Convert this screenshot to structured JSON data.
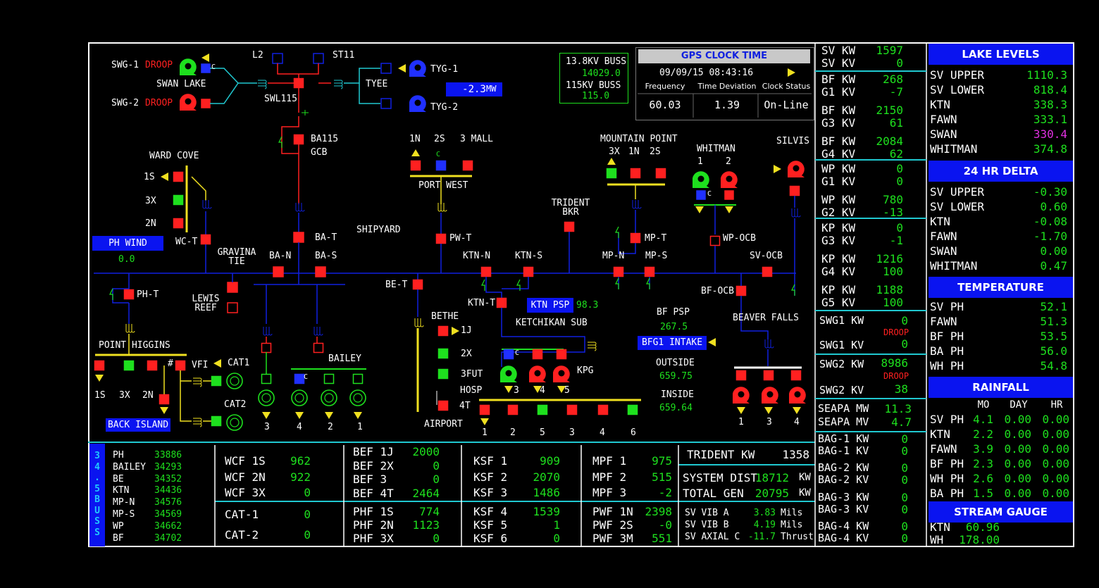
{
  "colors": {
    "background": "#000000",
    "bus_line": "#1020e0",
    "energized": "#ff2020",
    "deenergized": "#1ee01e",
    "value": "#1ee01e",
    "header_blue": "#0a14f0",
    "cyan_line": "#20c8d0",
    "yellow": "#f0e020"
  },
  "one_line": {
    "labels": {
      "swg1": "SWG-1",
      "swg2": "SWG-2",
      "droop1": "DROOP",
      "droop2": "DROOP",
      "swan_lake": "SWAN LAKE",
      "l2": "L2",
      "st11": "ST11",
      "swl115": "SWL115",
      "tyee": "TYEE",
      "tyg1": "TYG-1",
      "tyg2": "TYG-2",
      "tyee_mw_value": "-2.3",
      "tyee_mw_unit": "MW",
      "ba115": "BA115",
      "gcb": "GCB",
      "ward_cove": "WARD COVE",
      "wc_1s": "1S",
      "wc_3x": "3X",
      "wc_2n": "2N",
      "ph_wind": "PH WIND",
      "ph_wind_value": "0.0",
      "wc_t": "WC-T",
      "gravina_tie": "GRAVINA\nTIE",
      "ba_t": "BA-T",
      "ba_n": "BA-N",
      "ba_s": "BA-S",
      "shipyard": "SHIPYARD",
      "ph_t": "PH-T",
      "lewis_reef": "LEWIS\nREEF",
      "point_higgins": "POINT  HIGGINS",
      "ph_1s": "1S",
      "ph_3x": "3X",
      "ph_2n": "2N",
      "hash": "#",
      "vfi": "VFI",
      "cat1": "CAT1",
      "cat2": "CAT2",
      "back_island": "BACK ISLAND",
      "bailey": "BAILEY",
      "bailey_c": "C",
      "bailey_gen_3": "3",
      "bailey_gen_4": "4",
      "bailey_gen_2": "2",
      "bailey_gen_1": "1",
      "port_west": "PORT WEST",
      "pw_1n": "1N",
      "pw_2s": "2S",
      "pw_3mall": "3 MALL",
      "pw_c": "C",
      "pw_t": "PW-T",
      "be_t": "BE-T",
      "bethe": "BETHE",
      "be_1j": "1J",
      "be_2x": "2X",
      "be_3fut": "3FUT",
      "be_hosp": "HOSP",
      "be_4t": "4T",
      "airport": "AIRPORT",
      "ktn_n": "KTN-N",
      "ktn_s": "KTN-S",
      "ktn_t": "KTN-T",
      "ktn_psp": "KTN PSP",
      "ktn_psp_value": "98.3",
      "ketchikan_sub": "KETCHIKAN SUB",
      "kpg": "KPG",
      "kpg_c": "C",
      "kpg_3": "3",
      "kpg_4": "4",
      "kpg_5": "5",
      "ks_1": "1",
      "ks_2": "2",
      "ks_5": "5",
      "ks_3": "3",
      "ks_4": "4",
      "ks_6": "6",
      "trident_bkr": "TRIDENT\nBKR",
      "mountain_point": "MOUNTAIN POINT",
      "mp_3x": "3X",
      "mp_1n": "1N",
      "mp_2s": "2S",
      "mp_t": "MP-T",
      "mp_n": "MP-N",
      "mp_s": "MP-S",
      "whitman": "WHITMAN",
      "wh_1": "1",
      "wh_2": "2",
      "wh_c": "C",
      "wp_ocb": "WP-OCB",
      "silvis": "SILVIS",
      "sv_ocb": "SV-OCB",
      "bf_ocb": "BF-OCB",
      "beaver_falls": "BEAVER FALLS",
      "bf_1": "1",
      "bf_3": "3",
      "bf_4": "4",
      "bf_psp": "BF PSP",
      "bf_psp_value": "267.5",
      "bfg1_intake": "BFG1 INTAKE",
      "outside": "OUTSIDE",
      "outside_value": "659.75",
      "inside": "INSIDE",
      "inside_value": "659.64",
      "swg1_c": "C"
    }
  },
  "buss_box": {
    "line1": "13.8KV BUSS",
    "value1": "14029.0",
    "line2": "115KV BUSS",
    "value2": "115.0"
  },
  "gps": {
    "title": "GPS CLOCK TIME",
    "datetime": "09/09/15 08:43:16",
    "headers": [
      "Frequency",
      "Time Deviation",
      "Clock Status"
    ],
    "values": [
      "60.03",
      "1.39",
      "On-Line"
    ]
  },
  "buss_345": {
    "vertical_label": "34.5BUSS",
    "rows": [
      {
        "name": "PH",
        "value": "33886"
      },
      {
        "name": "BAILEY",
        "value": "34293"
      },
      {
        "name": "BE",
        "value": "34352"
      },
      {
        "name": "KTN",
        "value": "34436"
      },
      {
        "name": "MP-N",
        "value": "34576"
      },
      {
        "name": "MP-S",
        "value": "34569"
      },
      {
        "name": "WP",
        "value": "34662"
      },
      {
        "name": "BF",
        "value": "34702"
      }
    ]
  },
  "feeders": {
    "wcf": [
      {
        "name": "WCF 1S",
        "value": "962"
      },
      {
        "name": "WCF 2N",
        "value": "922"
      },
      {
        "name": "WCF 3X",
        "value": "0"
      }
    ],
    "cat": [
      {
        "name": "CAT-1",
        "value": "0"
      },
      {
        "name": "CAT-2",
        "value": "0"
      }
    ],
    "bef": [
      {
        "name": "BEF 1J",
        "value": "2000"
      },
      {
        "name": "BEF 2X",
        "value": "0"
      },
      {
        "name": "BEF 3",
        "value": "0"
      },
      {
        "name": "BEF 4T",
        "value": "2464"
      }
    ],
    "phf": [
      {
        "name": "PHF 1S",
        "value": "774"
      },
      {
        "name": "PHF 2N",
        "value": "1123"
      },
      {
        "name": "PHF 3X",
        "value": "0"
      }
    ],
    "ksf_a": [
      {
        "name": "KSF 1",
        "value": "909"
      },
      {
        "name": "KSF 2",
        "value": "2070"
      },
      {
        "name": "KSF 3",
        "value": "1486"
      }
    ],
    "ksf_b": [
      {
        "name": "KSF 4",
        "value": "1539"
      },
      {
        "name": "KSF 5",
        "value": "1"
      },
      {
        "name": "KSF 6",
        "value": "0"
      }
    ],
    "mpf": [
      {
        "name": "MPF 1",
        "value": "975"
      },
      {
        "name": "MPF 2",
        "value": "515"
      },
      {
        "name": "MPF 3",
        "value": "-2"
      }
    ],
    "pwf": [
      {
        "name": "PWF 1N",
        "value": "2398"
      },
      {
        "name": "PWF 2S",
        "value": "-0"
      },
      {
        "name": "PWF 3M",
        "value": "551"
      }
    ]
  },
  "totals": {
    "trident_label": "TRIDENT KW",
    "trident_value": "1358",
    "sysdist_label": "SYSTEM DIST",
    "sysdist_value": "18712",
    "sysdist_unit": "KW",
    "totalgen_label": "TOTAL GEN",
    "totalgen_value": "20795",
    "totalgen_unit": "KW",
    "vib": [
      {
        "name": "SV VIB A",
        "value": "3.83",
        "unit": "Mils"
      },
      {
        "name": "SV VIB B",
        "value": "4.19",
        "unit": "Mils"
      },
      {
        "name": "SV AXIAL C",
        "value": "-11.7",
        "unit": "Thrust"
      }
    ]
  },
  "gen_panel": {
    "sv": [
      {
        "name": "SV KW",
        "value": "1597"
      },
      {
        "name": "SV KV",
        "value": "0"
      }
    ],
    "bf": [
      {
        "name": "BF KW",
        "value": "268"
      },
      {
        "name": "G1 KV",
        "value": "-7"
      },
      {
        "name": "BF KW",
        "value": "2150"
      },
      {
        "name": "G3 KV",
        "value": "61"
      },
      {
        "name": "BF KW",
        "value": "2084"
      },
      {
        "name": "G4 KV",
        "value": "62"
      }
    ],
    "wp": [
      {
        "name": "WP KW",
        "value": "0"
      },
      {
        "name": "G1 KV",
        "value": "0"
      },
      {
        "name": "WP KW",
        "value": "780"
      },
      {
        "name": "G2 KV",
        "value": "-13"
      }
    ],
    "kp": [
      {
        "name": "KP KW",
        "value": "0"
      },
      {
        "name": "G3 KV",
        "value": "-1"
      },
      {
        "name": "KP KW",
        "value": "1216"
      },
      {
        "name": "G4 KV",
        "value": "100"
      },
      {
        "name": "KP KW",
        "value": "1188"
      },
      {
        "name": "G5 KV",
        "value": "100"
      }
    ],
    "swg1": {
      "kw_label": "SWG1 KW",
      "kw_value": "0",
      "droop": "DROOP",
      "kv_label": "SWG1 KV",
      "kv_value": "0"
    },
    "swg2": {
      "kw_label": "SWG2 KW",
      "kw_value": "8986",
      "droop": "DROOP",
      "kv_label": "SWG2 KV",
      "kv_value": "38"
    },
    "seapa": [
      {
        "name": "SEAPA MW",
        "value": "11.3"
      },
      {
        "name": "SEAPA MV",
        "value": "4.7"
      }
    ],
    "bag": [
      {
        "name": "BAG-1 KW",
        "value": "0"
      },
      {
        "name": "BAG-1 KV",
        "value": "0"
      },
      {
        "name": "BAG-2 KW",
        "value": "0"
      },
      {
        "name": "BAG-2 KV",
        "value": "0"
      },
      {
        "name": "BAG-3 KW",
        "value": "0"
      },
      {
        "name": "BAG-3 KV",
        "value": "0"
      },
      {
        "name": "BAG-4 KW",
        "value": "0"
      },
      {
        "name": "BAG-4 KV",
        "value": "0"
      }
    ]
  },
  "lake_levels": {
    "title": "LAKE LEVELS",
    "rows": [
      {
        "name": "SV UPPER",
        "value": "1110.3"
      },
      {
        "name": "SV LOWER",
        "value": "818.4"
      },
      {
        "name": "KTN",
        "value": "338.3"
      },
      {
        "name": "FAWN",
        "value": "333.1"
      },
      {
        "name": "SWAN",
        "value": "330.4",
        "color": "#e030e0"
      },
      {
        "name": "WHITMAN",
        "value": "374.8"
      }
    ]
  },
  "delta_24hr": {
    "title": "24 HR DELTA",
    "rows": [
      {
        "name": "SV UPPER",
        "value": "-0.30"
      },
      {
        "name": "SV LOWER",
        "value": "0.60"
      },
      {
        "name": "KTN",
        "value": "-0.08"
      },
      {
        "name": "FAWN",
        "value": "-1.70"
      },
      {
        "name": "SWAN",
        "value": "0.00"
      },
      {
        "name": "WHITMAN",
        "value": "0.47"
      }
    ]
  },
  "temperature": {
    "title": "TEMPERATURE",
    "rows": [
      {
        "name": "SV PH",
        "value": "52.1"
      },
      {
        "name": "FAWN",
        "value": "51.3"
      },
      {
        "name": "BF PH",
        "value": "53.5"
      },
      {
        "name": "BA PH",
        "value": "56.0"
      },
      {
        "name": "WH PH",
        "value": "54.8"
      }
    ]
  },
  "rainfall": {
    "title": "RAINFALL",
    "headers": [
      "MO",
      "DAY",
      "HR"
    ],
    "rows": [
      {
        "name": "SV PH",
        "mo": "4.1",
        "day": "0.00",
        "hr": "0.00"
      },
      {
        "name": "KTN",
        "mo": "2.2",
        "day": "0.00",
        "hr": "0.00"
      },
      {
        "name": "FAWN",
        "mo": "3.9",
        "day": "0.00",
        "hr": "0.00"
      },
      {
        "name": "BF PH",
        "mo": "2.3",
        "day": "0.00",
        "hr": "0.00"
      },
      {
        "name": "WH PH",
        "mo": "2.6",
        "day": "0.00",
        "hr": "0.00"
      },
      {
        "name": "BA PH",
        "mo": "1.5",
        "day": "0.00",
        "hr": "0.00"
      }
    ]
  },
  "stream_gauge": {
    "title": "STREAM GAUGE",
    "rows": [
      {
        "name": "KTN",
        "value": "60.96"
      },
      {
        "name": "WH",
        "value": "178.00"
      }
    ]
  }
}
